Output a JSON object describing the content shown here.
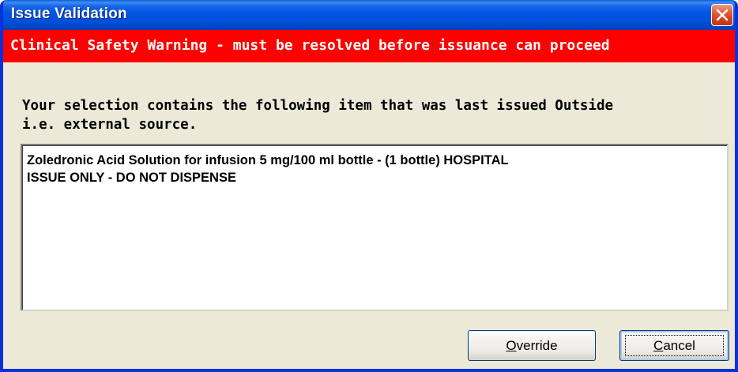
{
  "window": {
    "title": "Issue Validation"
  },
  "warning": {
    "text": "Clinical Safety Warning - must be resolved before issuance can proceed"
  },
  "message": {
    "line1": "Your selection contains the following item that was last issued Outside",
    "line2": "i.e. external source."
  },
  "items": {
    "line1": "Zoledronic Acid  Solution for infusion  5 mg/100 ml bottle - (1 bottle) HOSPITAL",
    "line2": "ISSUE ONLY - DO NOT DISPENSE"
  },
  "buttons": {
    "override_label": "Override",
    "cancel_label": "Cancel"
  },
  "colors": {
    "title_bar": "#0054e3",
    "warning_bar": "#ff0000",
    "dialog_bg": "#ece9d8",
    "close_button": "#e2613f"
  },
  "icons": {
    "close": "close-icon"
  }
}
